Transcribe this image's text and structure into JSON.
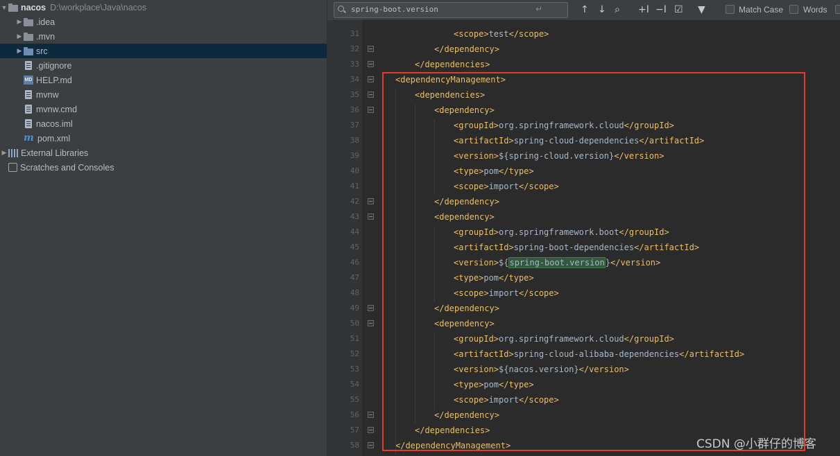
{
  "project_tree": {
    "root_name": "nacos",
    "root_path": "D:\\workplace\\Java\\nacos",
    "items": [
      {
        "label": ".idea",
        "kind": "folder"
      },
      {
        "label": ".mvn",
        "kind": "folder"
      },
      {
        "label": "src",
        "kind": "folder-blue"
      },
      {
        "label": ".gitignore",
        "kind": "file"
      },
      {
        "label": "HELP.md",
        "kind": "md"
      },
      {
        "label": "mvnw",
        "kind": "file"
      },
      {
        "label": "mvnw.cmd",
        "kind": "file"
      },
      {
        "label": "nacos.iml",
        "kind": "file"
      },
      {
        "label": "pom.xml",
        "kind": "maven"
      }
    ],
    "external_libraries": "External Libraries",
    "scratches": "Scratches and Consoles"
  },
  "search": {
    "query": "spring-boot.version",
    "match_case_label": "Match Case",
    "words_label": "Words",
    "md_badge": "MD"
  },
  "editor": {
    "lines": [
      {
        "n": "31",
        "indent": 2,
        "parts": [
          [
            "tag",
            "<scope>"
          ],
          [
            "txt",
            "test"
          ],
          [
            "tag",
            "</scope>"
          ]
        ]
      },
      {
        "n": "32",
        "indent": 1,
        "parts": [
          [
            "tag",
            "</dependency>"
          ]
        ]
      },
      {
        "n": "33",
        "indent": 0,
        "parts": [
          [
            "tag",
            "</dependencies>"
          ]
        ]
      },
      {
        "n": "34",
        "indent": -1,
        "parts": [
          [
            "tag",
            "<dependencyManagement>"
          ]
        ]
      },
      {
        "n": "35",
        "indent": 0,
        "parts": [
          [
            "tag",
            "<dependencies>"
          ]
        ]
      },
      {
        "n": "36",
        "indent": 1,
        "parts": [
          [
            "tag",
            "<dependency>"
          ]
        ]
      },
      {
        "n": "37",
        "indent": 2,
        "parts": [
          [
            "tag",
            "<groupId>"
          ],
          [
            "txt",
            "org.springframework.cloud"
          ],
          [
            "tag",
            "</groupId>"
          ]
        ]
      },
      {
        "n": "38",
        "indent": 2,
        "parts": [
          [
            "tag",
            "<artifactId>"
          ],
          [
            "txt",
            "spring-cloud-dependencies"
          ],
          [
            "tag",
            "</artifactId>"
          ]
        ]
      },
      {
        "n": "39",
        "indent": 2,
        "parts": [
          [
            "tag",
            "<version>"
          ],
          [
            "txt",
            "${spring-cloud.version}"
          ],
          [
            "tag",
            "</version>"
          ]
        ]
      },
      {
        "n": "40",
        "indent": 2,
        "parts": [
          [
            "tag",
            "<type>"
          ],
          [
            "txt",
            "pom"
          ],
          [
            "tag",
            "</type>"
          ]
        ]
      },
      {
        "n": "41",
        "indent": 2,
        "parts": [
          [
            "tag",
            "<scope>"
          ],
          [
            "txt",
            "import"
          ],
          [
            "tag",
            "</scope>"
          ]
        ]
      },
      {
        "n": "42",
        "indent": 1,
        "parts": [
          [
            "tag",
            "</dependency>"
          ]
        ]
      },
      {
        "n": "43",
        "indent": 1,
        "parts": [
          [
            "tag",
            "<dependency>"
          ]
        ]
      },
      {
        "n": "44",
        "indent": 2,
        "parts": [
          [
            "tag",
            "<groupId>"
          ],
          [
            "txt",
            "org.springframework.boot"
          ],
          [
            "tag",
            "</groupId>"
          ]
        ]
      },
      {
        "n": "45",
        "indent": 2,
        "parts": [
          [
            "tag",
            "<artifactId>"
          ],
          [
            "txt",
            "spring-boot-dependencies"
          ],
          [
            "tag",
            "</artifactId>"
          ]
        ]
      },
      {
        "n": "46",
        "indent": 2,
        "parts": [
          [
            "tag",
            "<version>"
          ],
          [
            "txt",
            "${"
          ],
          [
            "hl",
            "spring-boot.version"
          ],
          [
            "txt",
            "}"
          ],
          [
            "tag",
            "</version>"
          ]
        ]
      },
      {
        "n": "47",
        "indent": 2,
        "parts": [
          [
            "tag",
            "<type>"
          ],
          [
            "txt",
            "pom"
          ],
          [
            "tag",
            "</type>"
          ]
        ]
      },
      {
        "n": "48",
        "indent": 2,
        "parts": [
          [
            "tag",
            "<scope>"
          ],
          [
            "txt",
            "import"
          ],
          [
            "tag",
            "</scope>"
          ]
        ]
      },
      {
        "n": "49",
        "indent": 1,
        "parts": [
          [
            "tag",
            "</dependency>"
          ]
        ]
      },
      {
        "n": "50",
        "indent": 1,
        "parts": [
          [
            "tag",
            "<dependency>"
          ]
        ]
      },
      {
        "n": "51",
        "indent": 2,
        "parts": [
          [
            "tag",
            "<groupId>"
          ],
          [
            "txt",
            "org.springframework.cloud"
          ],
          [
            "tag",
            "</groupId>"
          ]
        ]
      },
      {
        "n": "52",
        "indent": 2,
        "parts": [
          [
            "tag",
            "<artifactId>"
          ],
          [
            "txt",
            "spring-cloud-alibaba-dependencies"
          ],
          [
            "tag",
            "</artifactId>"
          ]
        ]
      },
      {
        "n": "53",
        "indent": 2,
        "parts": [
          [
            "tag",
            "<version>"
          ],
          [
            "txt",
            "${nacos.version}"
          ],
          [
            "tag",
            "</version>"
          ]
        ]
      },
      {
        "n": "54",
        "indent": 2,
        "parts": [
          [
            "tag",
            "<type>"
          ],
          [
            "txt",
            "pom"
          ],
          [
            "tag",
            "</type>"
          ]
        ]
      },
      {
        "n": "55",
        "indent": 2,
        "parts": [
          [
            "tag",
            "<scope>"
          ],
          [
            "txt",
            "import"
          ],
          [
            "tag",
            "</scope>"
          ]
        ]
      },
      {
        "n": "56",
        "indent": 1,
        "parts": [
          [
            "tag",
            "</dependency>"
          ]
        ]
      },
      {
        "n": "57",
        "indent": 0,
        "parts": [
          [
            "tag",
            "</dependencies>"
          ]
        ]
      },
      {
        "n": "58",
        "indent": -1,
        "parts": [
          [
            "tag",
            "</dependencyManagement>"
          ]
        ]
      }
    ]
  },
  "watermark": "CSDN @小群仔的博客",
  "colors": {
    "tag": "#e8bf6a",
    "text": "#a9b7c6",
    "highlight_box": "#e53b2d"
  }
}
